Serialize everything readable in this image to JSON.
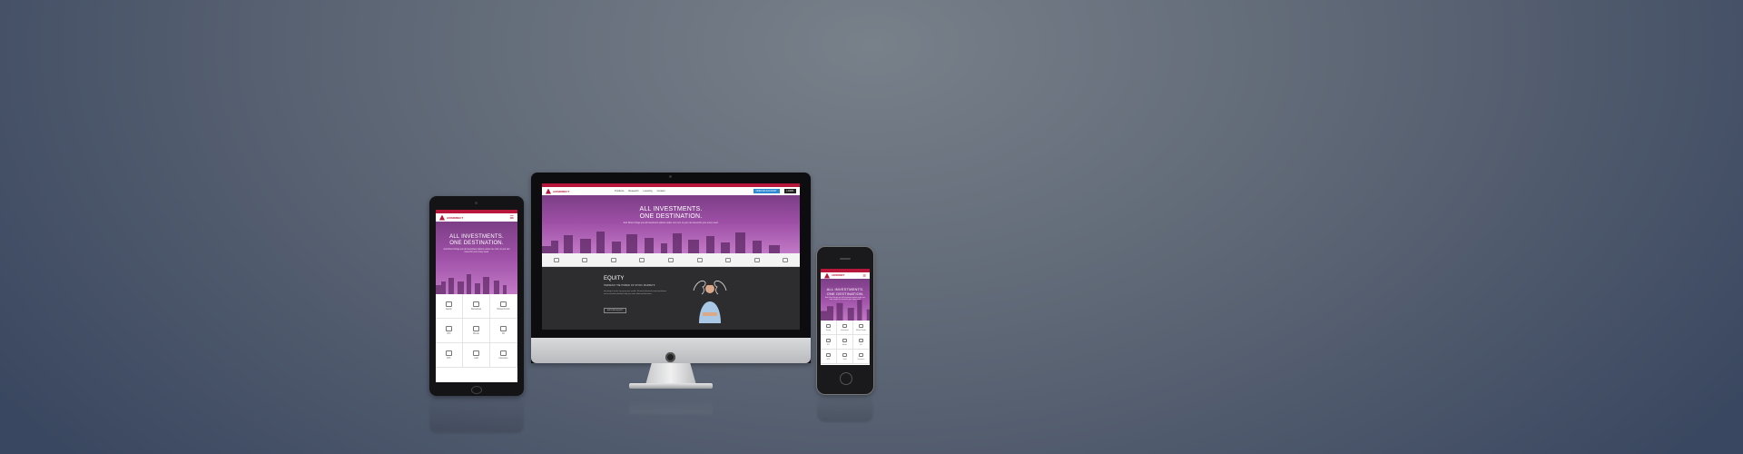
{
  "site": {
    "brand": "AXISDIRECT",
    "nav_items": [
      "Products",
      "Research",
      "Learning",
      "Contact"
    ],
    "open_account_label": "OPEN AN ACCOUNT",
    "login_label": "LOGIN",
    "hero_title_line1": "ALL INVESTMENTS.",
    "hero_title_line2": "ONE DESTINATION.",
    "hero_subtitle": "Axis Direct brings you all investment options under one roof, so you can invest for your every need.",
    "feature_title": "EQUITY",
    "feature_subtitle": "HARNESS THE POWER OF STOCK MARKETS",
    "feature_text": "Investing in stocks can grow your wealth. Research-backed recommendations and a seamless platform help you make informed decisions.",
    "feature_cta": "EXPLORE EQUITY"
  },
  "tablet_grid": [
    "Equity",
    "Derivatives",
    "Mutual Funds",
    "IPO",
    "Bonds",
    "FD",
    "ETF",
    "Gold",
    "Insurance"
  ],
  "colors": {
    "brand_red": "#b6173a",
    "hero_purple": "#9c4ea5",
    "feature_dark": "#2d2d30"
  }
}
